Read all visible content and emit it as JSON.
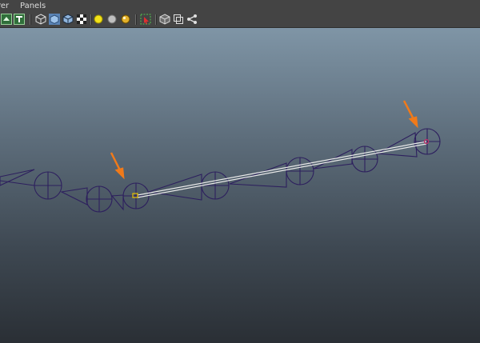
{
  "menubar": {
    "items": [
      "rer",
      "Panels"
    ]
  },
  "toolbar": {
    "icons": [
      "camera-attributes-icon",
      "text-icon",
      "wireframe-icon",
      "smooth-shade-icon",
      "wireframe-on-shaded-icon",
      "textured-icon",
      "lights-icon",
      "shadows-icon",
      "high-quality-icon",
      "isolate-select-icon",
      "xray-icon",
      "xray-joints-icon",
      "ik-handle-icon"
    ]
  },
  "colors": {
    "joint": "#2d1f5e",
    "ik_line": "#e9e9e9",
    "annotation_arrow": "#f07a1a",
    "selected_joint": "#e8c000",
    "end_effector": "#c0306a"
  }
}
